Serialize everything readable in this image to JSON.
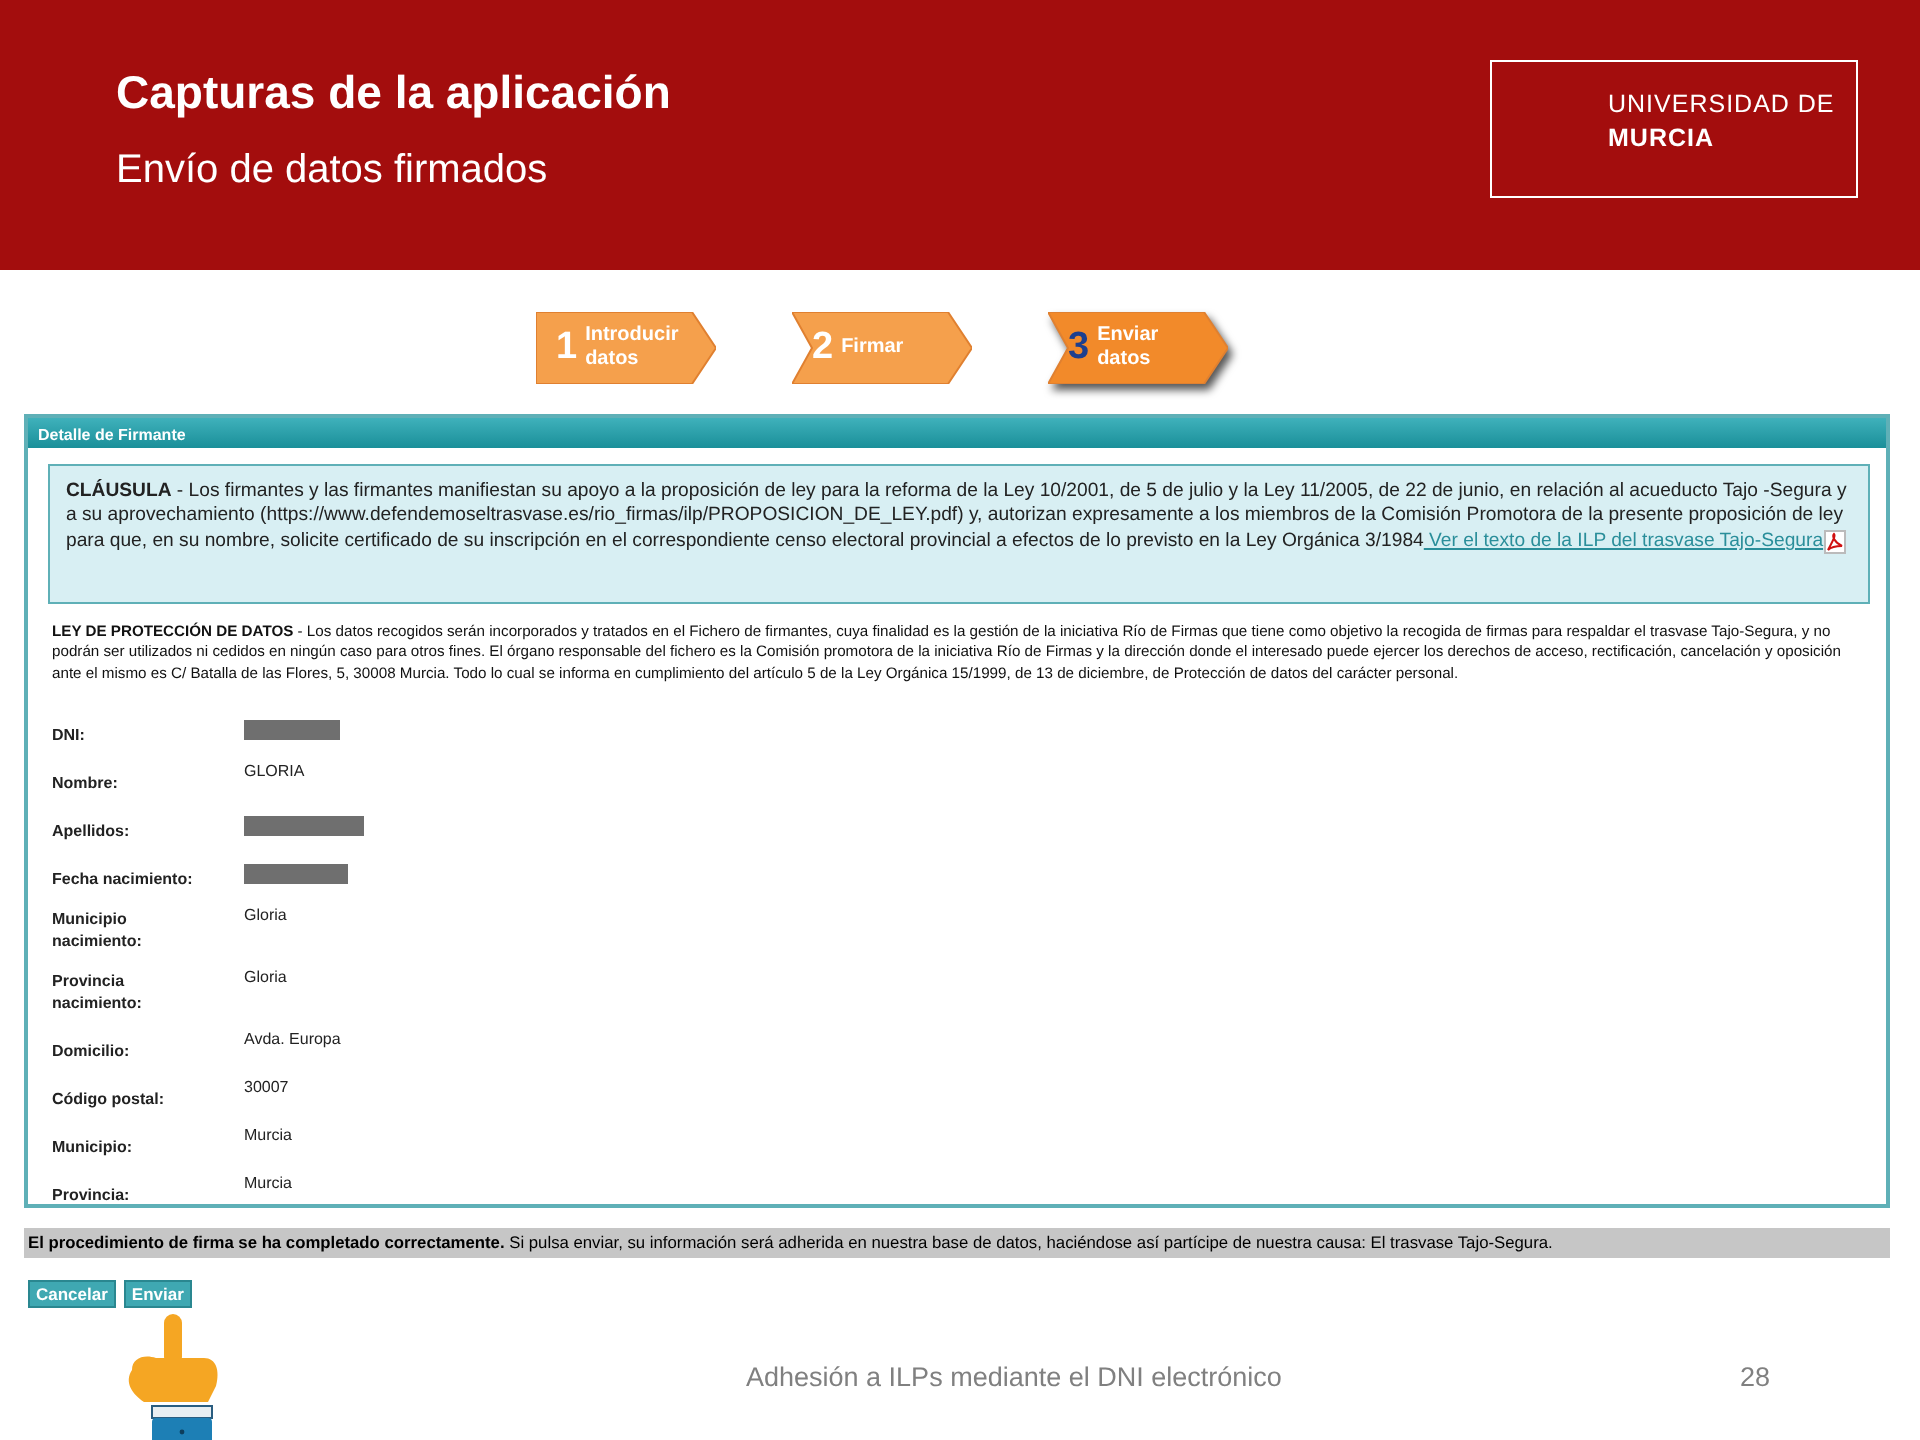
{
  "slide": {
    "title": "Capturas de la aplicación",
    "subtitle": "Envío de datos firmados",
    "logo": [
      "UNIVERSIDAD DE",
      "MURCIA"
    ]
  },
  "steps": [
    {
      "number": "1",
      "label": "Introducir datos",
      "selected": false
    },
    {
      "number": "2",
      "label": "Firmar",
      "selected": false
    },
    {
      "number": "3",
      "label": "Enviar datos",
      "selected": true
    }
  ],
  "panel": {
    "title": "Detalle de Firmante",
    "clause": {
      "text": "**CLÁUSULA** - Los firmantes y las firmantes manifiestan su apoyo a la proposición de ley para la reforma de la Ley 10/2001, de 5 de julio y la Ley 11/2005, de 22 de junio, en relación al acueducto Tajo -Segura y a su aprovechamiento (https://www.defendemoseltrasvase.es/rio_firmas/ilp/PROPOSICION_DE_LEY.pdf) y, autorizan expresamente a los miembros de la Comisión Promotora de la presente proposición de ley para que, en su nombre, solicite certificado de su inscripción en el correspondiente censo electoral provincial a efectos de lo previsto en la Ley Orgánica 3/1984",
      "link": " Ver el texto de la ILP del trasvase Tajo-Segura"
    },
    "privacy": "**LEY DE PROTECCIÓN DE DATOS** - Los datos recogidos serán incorporados y tratados en el Fichero de firmantes, cuya finalidad es la gestión de la iniciativa Río de Firmas que tiene como objetivo la recogida de firmas para respaldar el trasvase Tajo-Segura, y no podrán ser utilizados ni cedidos en ningún caso para otros fines. El órgano responsable del fichero es la Comisión promotora de la iniciativa Río de Firmas y la dirección donde el interesado puede ejercer los derechos de acceso, rectificación, cancelación y oposición ante el mismo es C/ Batalla de las Flores, 5, 30008 Murcia. Todo lo cual se informa en cumplimiento del artículo 5 de la Ley Orgánica 15/1999, de 13 de diciembre, de Protección de datos del carácter personal.",
    "fields": [
      {
        "label": "DNI:",
        "kind": "redacted"
      },
      {
        "label": "Nombre:",
        "value": "GLORIA",
        "kind": "text"
      },
      {
        "label": "Apellidos:",
        "kind": "redacted"
      },
      {
        "label": "Fecha nacimiento:",
        "kind": "redacted"
      },
      {
        "label": "Municipio nacimiento:",
        "value": "Gloria",
        "kind": "text"
      },
      {
        "label": "Provincia nacimiento:",
        "value": "Gloria",
        "kind": "text"
      },
      {
        "label": "Domicilio:",
        "value": "Avda. Europa",
        "kind": "text"
      },
      {
        "label": "Código postal:",
        "value": "30007",
        "kind": "text"
      },
      {
        "label": "Municipio:",
        "value": "Murcia",
        "kind": "text"
      },
      {
        "label": "Provincia:",
        "value": "Murcia",
        "kind": "text"
      }
    ]
  },
  "status": "**El procedimiento de firma se ha completado correctamente.** Si pulsa enviar, su información será adherida en nuestra base de datos, haciéndose así partícipe de nuestra causa: El trasvase Tajo-Segura.",
  "buttons": [
    "Cancelar",
    "Enviar"
  ],
  "footer": {
    "text": "Adhesión a ILPs mediante el DNI electrónico",
    "page": "28"
  }
}
